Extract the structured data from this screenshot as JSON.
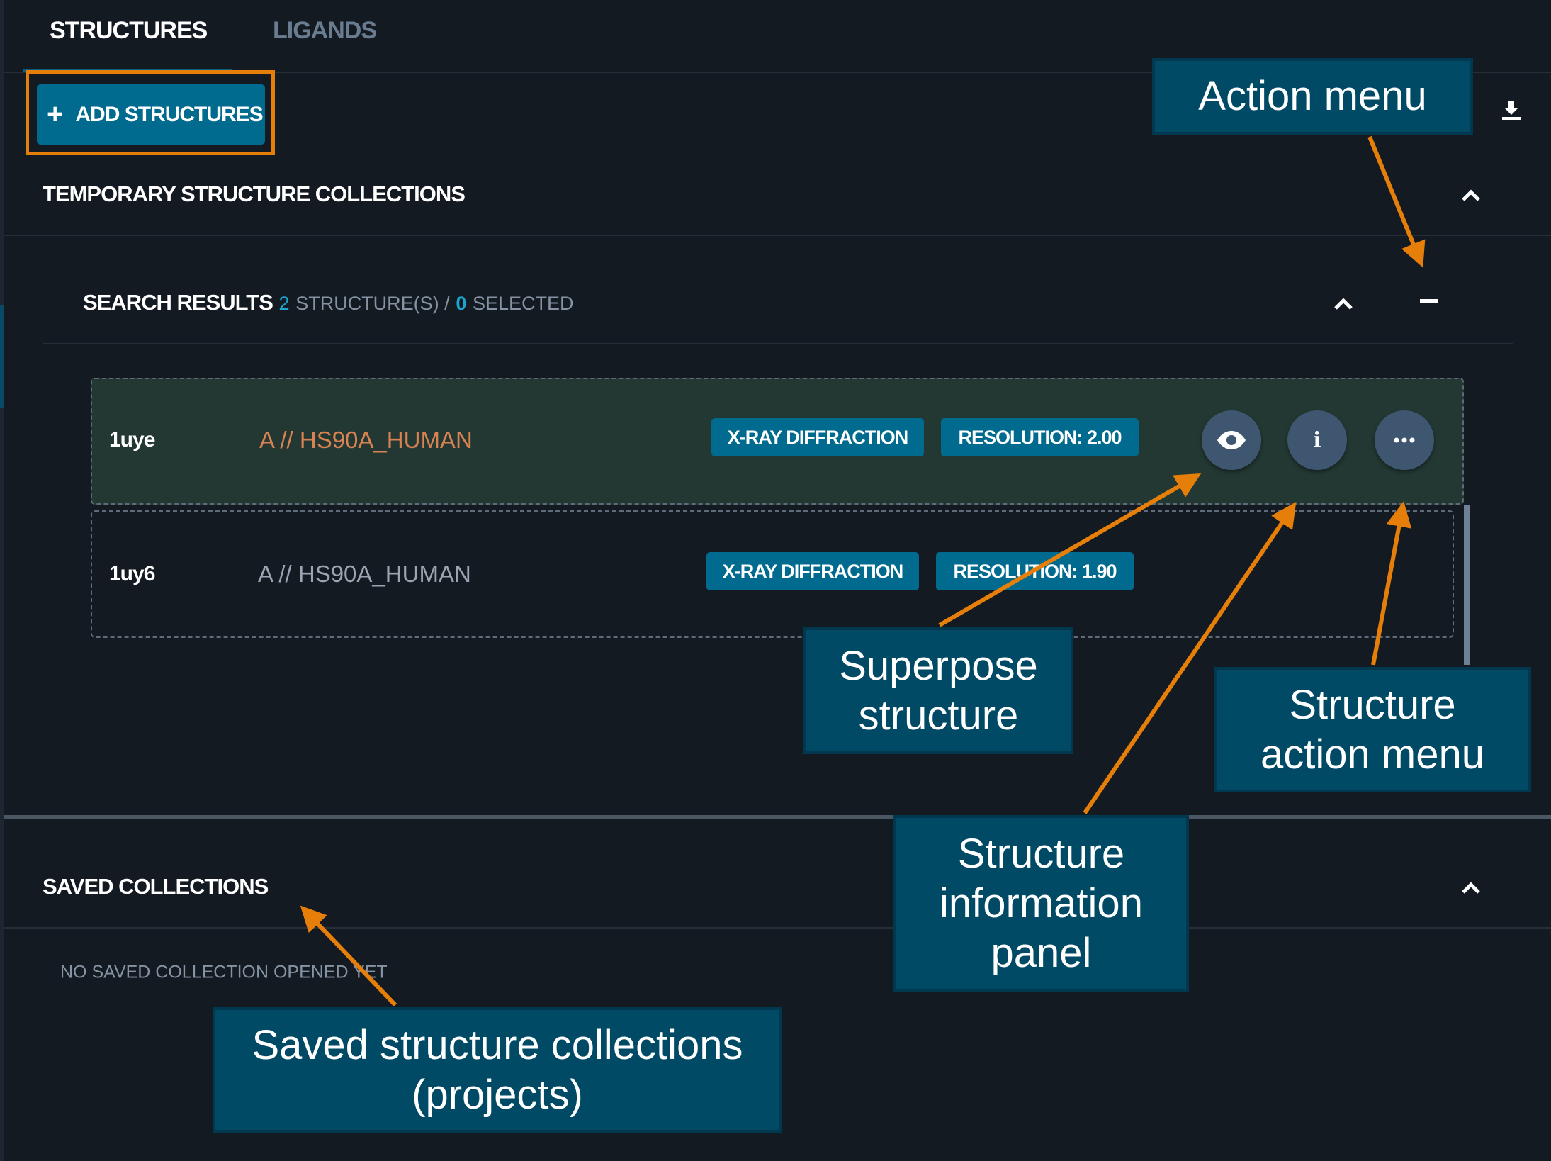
{
  "tabs": [
    {
      "label": "STRUCTURES",
      "active": true
    },
    {
      "label": "LIGANDS",
      "active": false
    }
  ],
  "toolbar": {
    "add_label": "ADD STRUCTURES",
    "add_icon": "plus-icon",
    "download_icon": "download-icon"
  },
  "temporary": {
    "title": "TEMPORARY STRUCTURE COLLECTIONS",
    "search_results": {
      "title": "SEARCH RESULTS",
      "count": "2",
      "count_label": "STRUCTURE(S) /",
      "selected": "0",
      "selected_label": "SELECTED"
    },
    "rows": [
      {
        "id": "1uye",
        "chain": "A // HS90A_HUMAN",
        "method": "X-RAY DIFFRACTION",
        "resolution": "RESOLUTION: 2.00",
        "highlighted": true
      },
      {
        "id": "1uy6",
        "chain": "A // HS90A_HUMAN",
        "method": "X-RAY DIFFRACTION",
        "resolution": "RESOLUTION: 1.90",
        "highlighted": false
      }
    ]
  },
  "saved": {
    "title": "SAVED COLLECTIONS",
    "empty": "NO SAVED COLLECTION OPENED YET"
  },
  "annotations": {
    "action_menu": "Action menu",
    "superpose": [
      "Superpose",
      "structure"
    ],
    "structure_action_menu": [
      "Structure",
      "action menu"
    ],
    "info_panel": [
      "Structure",
      "information",
      "panel"
    ],
    "saved": [
      "Saved structure collections",
      "(projects)"
    ]
  },
  "colors": {
    "background": "#141a22",
    "accent": "#006b8f",
    "annotation": "#e67e0a",
    "callout": "#004a66",
    "highlight_row": "#233833"
  }
}
